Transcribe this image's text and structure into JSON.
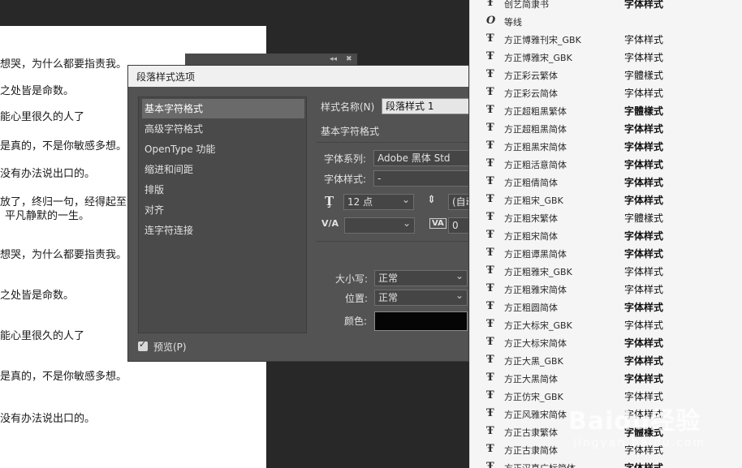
{
  "document": {
    "lines": [
      "想哭，为什么都要指责我。",
      "之处皆是命数。",
      "能心里很久的人了",
      "是真的，不是你敏感多想。",
      "没有办法说出口的。",
      "放了，终归一句，经得起至",
      "平凡静默的一生。",
      "想哭，为什么都要指责我。",
      "之处皆是命数。",
      "能心里很久的人了",
      "是真的，不是你敏感多想。",
      "没有办法说出口的。"
    ]
  },
  "mini_panel": {
    "collapse": "◂◂",
    "close": "✖"
  },
  "dialog": {
    "title": "段落样式选项",
    "categories": [
      "基本字符格式",
      "高级字符格式",
      "OpenType 功能",
      "缩进和间距",
      "排版",
      "对齐",
      "连字符连接"
    ],
    "preview_label": "预览(P)",
    "style_name_label": "样式名称(N)",
    "style_name_value": "段落样式 1",
    "section_title": "基本字符格式",
    "font_family_label": "字体系列:",
    "font_family_value": "Adobe 黑体 Std",
    "font_style_label": "字体样式:",
    "font_style_value": "-",
    "font_size_value": "12 点",
    "leading_value": "(自动",
    "tracking_value": "0",
    "kerning_icon_text": "V/A",
    "tracking_icon_text": "VA",
    "case_label": "大小写:",
    "case_value": "正常",
    "position_label": "位置:",
    "position_value": "正常",
    "color_label": "颜色:",
    "color_value": "#050505"
  },
  "font_menu": {
    "items": [
      {
        "name": "创艺简隶书",
        "sample": "字体样式",
        "icon": "truetype-icon"
      },
      {
        "name": "等线",
        "sample": "",
        "icon": "opentype-icon"
      },
      {
        "name": "方正博雅刊宋_GBK",
        "sample": "字体样式",
        "icon": "truetype-icon"
      },
      {
        "name": "方正博雅宋_GBK",
        "sample": "字体样式",
        "icon": "truetype-icon"
      },
      {
        "name": "方正彩云繁体",
        "sample": "字體樣式",
        "icon": "truetype-icon"
      },
      {
        "name": "方正彩云简体",
        "sample": "字体样式",
        "icon": "truetype-icon"
      },
      {
        "name": "方正超粗黑繁体",
        "sample": "字體樣式",
        "icon": "truetype-icon"
      },
      {
        "name": "方正超粗黑简体",
        "sample": "字体样式",
        "icon": "truetype-icon"
      },
      {
        "name": "方正粗黑宋简体",
        "sample": "字体样式",
        "icon": "truetype-icon"
      },
      {
        "name": "方正粗活意简体",
        "sample": "字体样式",
        "icon": "truetype-icon"
      },
      {
        "name": "方正粗倩简体",
        "sample": "字体样式",
        "icon": "truetype-icon"
      },
      {
        "name": "方正粗宋_GBK",
        "sample": "字体样式",
        "icon": "truetype-icon"
      },
      {
        "name": "方正粗宋繁体",
        "sample": "字體樣式",
        "icon": "truetype-icon"
      },
      {
        "name": "方正粗宋简体",
        "sample": "字体样式",
        "icon": "truetype-icon"
      },
      {
        "name": "方正粗谭黑简体",
        "sample": "字体样式",
        "icon": "truetype-icon"
      },
      {
        "name": "方正粗雅宋_GBK",
        "sample": "字体样式",
        "icon": "truetype-icon"
      },
      {
        "name": "方正粗雅宋简体",
        "sample": "字体样式",
        "icon": "truetype-icon"
      },
      {
        "name": "方正粗圆简体",
        "sample": "字体样式",
        "icon": "truetype-icon"
      },
      {
        "name": "方正大标宋_GBK",
        "sample": "字体样式",
        "icon": "truetype-icon"
      },
      {
        "name": "方正大标宋简体",
        "sample": "字体样式",
        "icon": "truetype-icon"
      },
      {
        "name": "方正大黑_GBK",
        "sample": "字体样式",
        "icon": "truetype-icon"
      },
      {
        "name": "方正大黑简体",
        "sample": "字体样式",
        "icon": "truetype-icon"
      },
      {
        "name": "方正仿宋_GBK",
        "sample": "字体样式",
        "icon": "truetype-icon"
      },
      {
        "name": "方正风雅宋简体",
        "sample": "字体样式",
        "icon": "truetype-icon"
      },
      {
        "name": "方正古隶繁体",
        "sample": "字體樣式",
        "icon": "truetype-icon"
      },
      {
        "name": "方正古隶简体",
        "sample": "字体样式",
        "icon": "truetype-icon"
      },
      {
        "name": "方正汉真广标简体",
        "sample": "字体样式",
        "icon": "truetype-icon"
      }
    ],
    "bold_samples": [
      0,
      6,
      7,
      8,
      9,
      10,
      11,
      13,
      14,
      17,
      19,
      20,
      21,
      24,
      26
    ]
  },
  "watermark": {
    "main": "Baidu经验",
    "sub": "jingyan.baidu.com"
  }
}
